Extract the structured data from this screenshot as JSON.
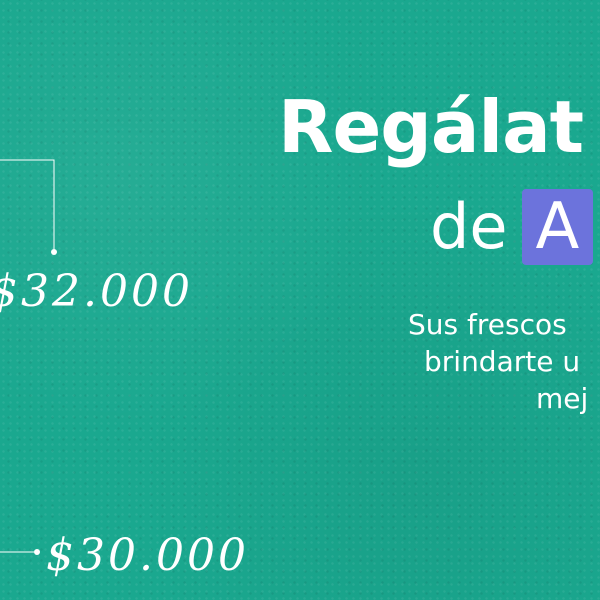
{
  "headline": "Regálat",
  "subline": {
    "prefix": "de",
    "highlight": "A"
  },
  "description": [
    "Sus frescos",
    "brindarte u",
    "mej"
  ],
  "prices": [
    "$32.000",
    "$30.000"
  ],
  "colors": {
    "background": "#1aa88f",
    "highlight_box": "#6c73dc",
    "text": "#ffffff"
  }
}
